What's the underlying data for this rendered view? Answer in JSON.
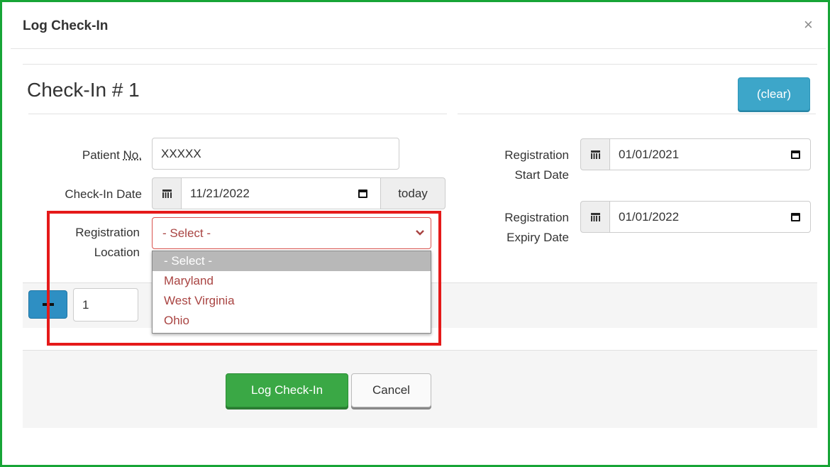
{
  "dialog": {
    "title": "Log Check-In",
    "close_glyph": "×"
  },
  "form": {
    "heading": "Check-In # 1",
    "clear_label": "(clear)",
    "patient_label_prefix": "Patient ",
    "patient_label_abbr": "No.",
    "patient_value": "XXXXX",
    "checkin_date_label": "Check-In Date",
    "checkin_date_value": "11/21/2022",
    "today_label": "today",
    "location_label_line1": "Registration",
    "location_label_line2": "Location",
    "location_selected": "- Select -",
    "location_options": [
      "- Select -",
      "Maryland",
      "West Virginia",
      "Ohio"
    ],
    "reg_start_label_line1": "Registration",
    "reg_start_label_line2": "Start Date",
    "reg_start_value": "01/01/2021",
    "reg_expiry_label_line1": "Registration",
    "reg_expiry_label_line2": "Expiry Date",
    "reg_expiry_value": "01/01/2022"
  },
  "quantity": {
    "value": "1"
  },
  "footer": {
    "submit_label": "Log Check-In",
    "cancel_label": "Cancel"
  },
  "colors": {
    "frame": "#17a536",
    "highlight": "#e51a1a",
    "submit": "#3aa845",
    "clear": "#3da6c9",
    "error_text": "#a94442"
  },
  "icons": [
    "calendar-icon",
    "date-picker-icon",
    "chevron-down-icon",
    "minus-icon",
    "close-icon"
  ]
}
